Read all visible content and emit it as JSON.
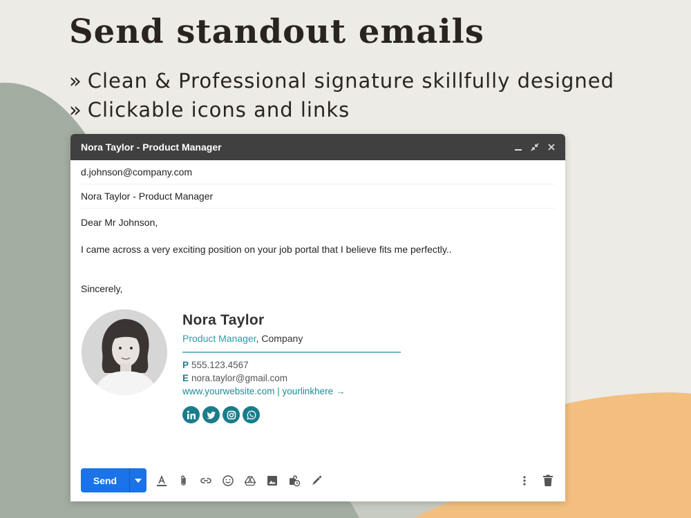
{
  "headline": "Send standout emails",
  "bullets": [
    {
      "mark": "»",
      "text": "Clean & Professional signature skillfully designed"
    },
    {
      "mark": "»",
      "text": "Clickable icons and links"
    }
  ],
  "compose": {
    "title": "Nora Taylor - Product Manager",
    "to": "d.johnson@company.com",
    "subject": "Nora Taylor - Product Manager",
    "body": {
      "greeting": "Dear Mr Johnson,",
      "message": "I came across a very exciting position on your job portal that I believe fits me perfectly..",
      "closing": "Sincerely,"
    },
    "signature": {
      "name": "Nora Taylor",
      "role": "Product Manager",
      "company": ", Company",
      "phone_label": "P",
      "phone": "555.123.4567",
      "email_label": "E",
      "email": "nora.taylor@gmail.com",
      "links": "www.yourwebsite.com | yourlinkhere →",
      "socials": [
        "linkedin-icon",
        "twitter-icon",
        "instagram-icon",
        "whatsapp-icon"
      ]
    },
    "toolbar": {
      "send_label": "Send",
      "tools": [
        "text-format-icon",
        "attach-icon",
        "link-icon",
        "emoji-icon",
        "drive-icon",
        "image-icon",
        "confidential-icon",
        "signature-icon"
      ]
    }
  },
  "colors": {
    "accent": "#2e98a8",
    "send_button": "#1a73e8",
    "titlebar": "#404040",
    "sage_shape": "#a3aca0",
    "peach_shape": "#f3bf7f"
  }
}
